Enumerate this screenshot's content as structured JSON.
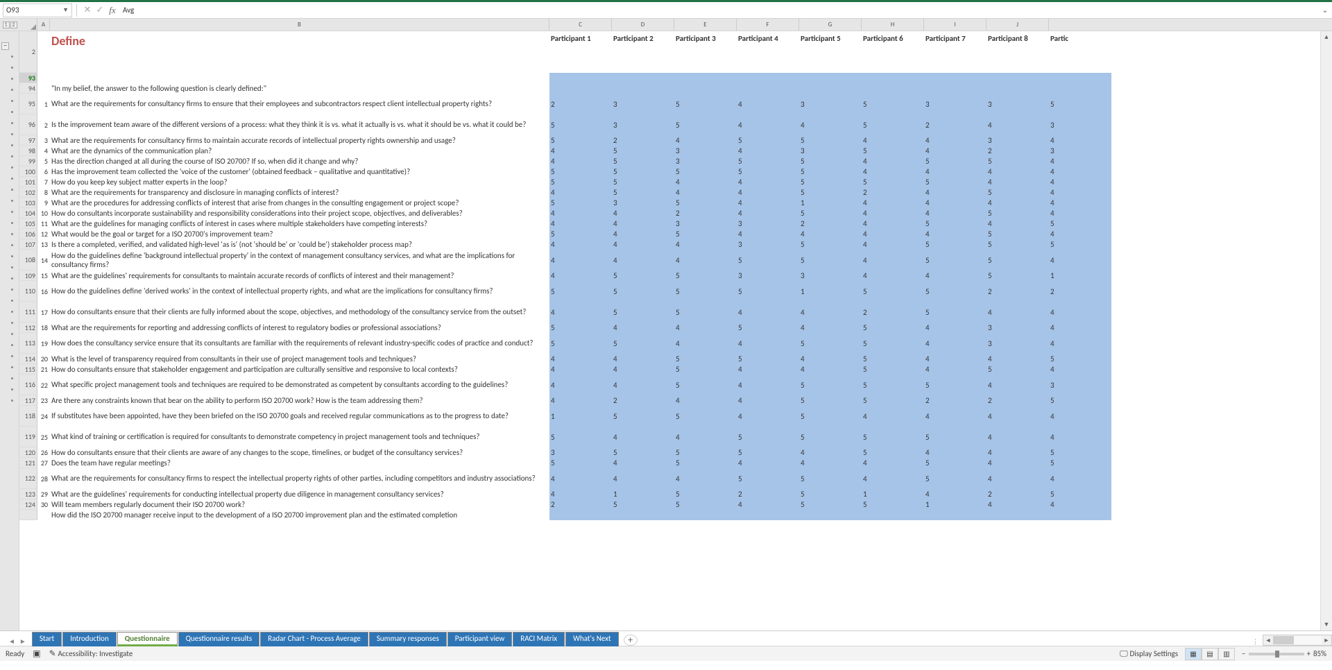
{
  "formula_bar": {
    "name_box": "O93",
    "content": "Avg"
  },
  "outline": {
    "buttons": [
      "1",
      "2"
    ]
  },
  "col_headers": [
    "A",
    "B",
    "C",
    "D",
    "E",
    "F",
    "G",
    "H",
    "I",
    "J"
  ],
  "title": {
    "row_num": "2",
    "text": "Define"
  },
  "participant_headers": [
    "Participant 1",
    "Participant 2",
    "Participant 3",
    "Participant 4",
    "Participant 5",
    "Participant 6",
    "Participant 7",
    "Participant 8",
    "Partic"
  ],
  "rows": [
    {
      "r": "93",
      "a": "",
      "b": "",
      "vals": [],
      "h": "single",
      "no_bg": true,
      "selected": true
    },
    {
      "r": "94",
      "a": "",
      "b": "\"In my belief, the answer to the following question is clearly defined:\"",
      "vals": [],
      "h": "single",
      "no_bg": true
    },
    {
      "r": "95",
      "a": "1",
      "b": "What are the requirements for consultancy firms to ensure that their employees and subcontractors respect client intellectual property rights?",
      "vals": [
        "2",
        "3",
        "5",
        "4",
        "3",
        "5",
        "3",
        "3",
        "5"
      ],
      "h": "double"
    },
    {
      "r": "96",
      "a": "2",
      "b": "Is the improvement team aware of the different versions of a process: what they think it is vs. what it actually is vs. what it should be vs. what it could be?",
      "vals": [
        "5",
        "3",
        "5",
        "4",
        "4",
        "5",
        "2",
        "4",
        "3"
      ],
      "h": "double"
    },
    {
      "r": "97",
      "a": "3",
      "b": "What are the requirements for consultancy firms to maintain accurate records of intellectual property rights ownership and usage?",
      "vals": [
        "5",
        "2",
        "4",
        "5",
        "5",
        "4",
        "4",
        "3",
        "4"
      ],
      "h": "single"
    },
    {
      "r": "98",
      "a": "4",
      "b": "What are the dynamics of the communication plan?",
      "vals": [
        "4",
        "5",
        "3",
        "4",
        "3",
        "5",
        "4",
        "2",
        "3"
      ],
      "h": "single"
    },
    {
      "r": "99",
      "a": "5",
      "b": "Has the direction changed at all during the course of ISO 20700? If so, when did it change and why?",
      "vals": [
        "4",
        "5",
        "3",
        "5",
        "5",
        "4",
        "5",
        "5",
        "4"
      ],
      "h": "single"
    },
    {
      "r": "100",
      "a": "6",
      "b": "Has the improvement team collected the 'voice of the customer' (obtained feedback – qualitative and quantitative)?",
      "vals": [
        "5",
        "5",
        "5",
        "5",
        "5",
        "4",
        "4",
        "4",
        "4"
      ],
      "h": "single"
    },
    {
      "r": "101",
      "a": "7",
      "b": "How do you keep key subject matter experts in the loop?",
      "vals": [
        "5",
        "5",
        "4",
        "4",
        "5",
        "5",
        "5",
        "4",
        "4"
      ],
      "h": "single"
    },
    {
      "r": "102",
      "a": "8",
      "b": "What are the requirements for transparency and disclosure in managing conflicts of interest?",
      "vals": [
        "4",
        "5",
        "4",
        "4",
        "5",
        "2",
        "4",
        "5",
        "4"
      ],
      "h": "single"
    },
    {
      "r": "103",
      "a": "9",
      "b": "What are the procedures for addressing conflicts of interest that arise from changes in the consulting engagement or project scope?",
      "vals": [
        "5",
        "3",
        "5",
        "4",
        "1",
        "4",
        "4",
        "4",
        "4"
      ],
      "h": "single"
    },
    {
      "r": "104",
      "a": "10",
      "b": "How do consultants incorporate sustainability and responsibility considerations into their project scope, objectives, and deliverables?",
      "vals": [
        "4",
        "4",
        "2",
        "4",
        "5",
        "4",
        "4",
        "5",
        "4"
      ],
      "h": "single"
    },
    {
      "r": "105",
      "a": "11",
      "b": "What are the guidelines for managing conflicts of interest in cases where multiple stakeholders have competing interests?",
      "vals": [
        "4",
        "4",
        "3",
        "3",
        "2",
        "4",
        "5",
        "4",
        "5"
      ],
      "h": "single"
    },
    {
      "r": "106",
      "a": "12",
      "b": "What would be the goal or target for a ISO 20700's improvement team?",
      "vals": [
        "5",
        "4",
        "5",
        "4",
        "4",
        "4",
        "4",
        "5",
        "4"
      ],
      "h": "single"
    },
    {
      "r": "107",
      "a": "13",
      "b": "Is there a completed, verified, and validated high-level 'as is' (not 'should be' or 'could be') stakeholder process map?",
      "vals": [
        "4",
        "4",
        "4",
        "3",
        "5",
        "4",
        "5",
        "5",
        "5"
      ],
      "h": "single"
    },
    {
      "r": "108",
      "a": "14",
      "b": "How do the guidelines define 'background intellectual property' in the context of management consultancy services, and what are the implications for consultancy firms?",
      "vals": [
        "4",
        "4",
        "4",
        "5",
        "5",
        "4",
        "5",
        "5",
        "4"
      ],
      "h": "double"
    },
    {
      "r": "109",
      "a": "15",
      "b": "What are the guidelines' requirements for consultants to maintain accurate records of conflicts of interest and their management?",
      "vals": [
        "4",
        "5",
        "5",
        "3",
        "3",
        "4",
        "4",
        "5",
        "1"
      ],
      "h": "single"
    },
    {
      "r": "110",
      "a": "16",
      "b": "How do the guidelines define 'derived works' in the context of intellectual property rights, and what are the implications for consultancy firms?",
      "vals": [
        "5",
        "5",
        "5",
        "5",
        "1",
        "5",
        "5",
        "2",
        "2"
      ],
      "h": "double"
    },
    {
      "r": "111",
      "a": "17",
      "b": "How do consultants ensure that their clients are fully informed about the scope, objectives, and methodology of the consultancy service from the outset?",
      "vals": [
        "4",
        "5",
        "5",
        "4",
        "4",
        "2",
        "5",
        "4",
        "4"
      ],
      "h": "double"
    },
    {
      "r": "112",
      "a": "18",
      "b": "What are the requirements for reporting and addressing conflicts of interest to regulatory bodies or professional associations?",
      "vals": [
        "5",
        "4",
        "4",
        "5",
        "4",
        "5",
        "4",
        "3",
        "4"
      ],
      "h": "single"
    },
    {
      "r": "113",
      "a": "19",
      "b": "How does the consultancy service ensure that its consultants are familiar with the requirements of relevant industry-specific codes of practice and conduct?",
      "vals": [
        "5",
        "5",
        "4",
        "4",
        "5",
        "5",
        "4",
        "3",
        "4"
      ],
      "h": "double"
    },
    {
      "r": "114",
      "a": "20",
      "b": "What is the level of transparency required from consultants in their use of project management tools and techniques?",
      "vals": [
        "4",
        "4",
        "5",
        "5",
        "4",
        "5",
        "4",
        "4",
        "5"
      ],
      "h": "single"
    },
    {
      "r": "115",
      "a": "21",
      "b": "How do consultants ensure that stakeholder engagement and participation are culturally sensitive and responsive to local contexts?",
      "vals": [
        "4",
        "4",
        "5",
        "4",
        "4",
        "5",
        "4",
        "5",
        "4"
      ],
      "h": "single"
    },
    {
      "r": "116",
      "a": "22",
      "b": "What specific project management tools and techniques are required to be demonstrated as competent by consultants according to the guidelines?",
      "vals": [
        "4",
        "4",
        "5",
        "4",
        "5",
        "5",
        "5",
        "4",
        "3"
      ],
      "h": "double"
    },
    {
      "r": "117",
      "a": "23",
      "b": "Are there any constraints known that bear on the ability to perform ISO 20700 work? How is the team addressing them?",
      "vals": [
        "4",
        "2",
        "4",
        "4",
        "5",
        "5",
        "2",
        "2",
        "5"
      ],
      "h": "single"
    },
    {
      "r": "118",
      "a": "24",
      "b": "If substitutes have been appointed, have they been briefed on the ISO 20700 goals and received regular communications as to the progress to date?",
      "vals": [
        "1",
        "5",
        "5",
        "4",
        "5",
        "4",
        "4",
        "4",
        "4"
      ],
      "h": "double"
    },
    {
      "r": "119",
      "a": "25",
      "b": "What kind of training or certification is required for consultants to demonstrate competency in project management tools and techniques?",
      "vals": [
        "5",
        "4",
        "4",
        "5",
        "5",
        "5",
        "5",
        "4",
        "4"
      ],
      "h": "double"
    },
    {
      "r": "120",
      "a": "26",
      "b": "How do consultants ensure that their clients are aware of any changes to the scope, timelines, or budget of the consultancy services?",
      "vals": [
        "3",
        "5",
        "5",
        "5",
        "4",
        "5",
        "4",
        "4",
        "5"
      ],
      "h": "single"
    },
    {
      "r": "121",
      "a": "27",
      "b": "Does the team have regular meetings?",
      "vals": [
        "5",
        "4",
        "5",
        "4",
        "4",
        "4",
        "5",
        "4",
        "5"
      ],
      "h": "single"
    },
    {
      "r": "122",
      "a": "28",
      "b": "What are the requirements for consultancy firms to respect the intellectual property rights of other parties, including competitors and industry associations?",
      "vals": [
        "4",
        "4",
        "4",
        "5",
        "5",
        "4",
        "5",
        "4",
        "4"
      ],
      "h": "double"
    },
    {
      "r": "123",
      "a": "29",
      "b": "What are the guidelines' requirements for conducting intellectual property due diligence in management consultancy services?",
      "vals": [
        "4",
        "1",
        "5",
        "2",
        "5",
        "1",
        "4",
        "2",
        "5"
      ],
      "h": "single"
    },
    {
      "r": "124",
      "a": "30",
      "b": "Will team members regularly document their ISO 20700 work?",
      "vals": [
        "2",
        "5",
        "5",
        "4",
        "5",
        "5",
        "1",
        "4",
        "4"
      ],
      "h": "single"
    },
    {
      "r": "",
      "a": "",
      "b": "How did the ISO 20700 manager receive input to the development of a ISO 20700 improvement plan and the estimated completion",
      "vals": [],
      "h": "single",
      "partial": true
    }
  ],
  "tabs": [
    "Start",
    "Introduction",
    "Questionnaire",
    "Questionnaire results",
    "Radar Chart - Process Average",
    "Summary responses",
    "Participant view",
    "RACI Matrix",
    "What's Next"
  ],
  "active_tab_index": 2,
  "status": {
    "ready": "Ready",
    "accessibility": "Accessibility: Investigate",
    "display": "Display Settings",
    "zoom": "85%"
  }
}
